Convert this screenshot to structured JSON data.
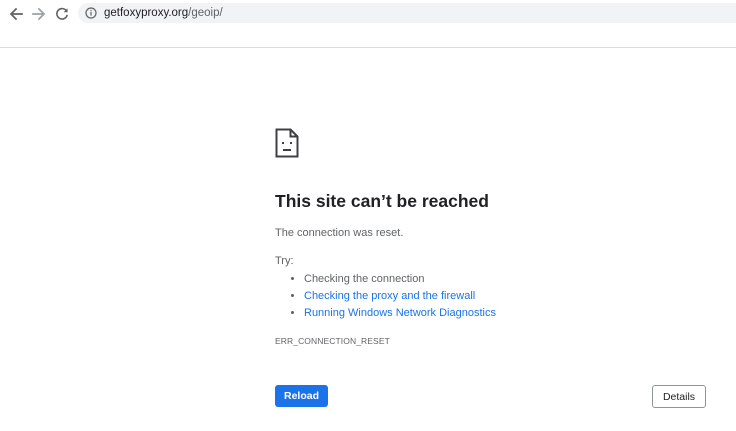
{
  "browser": {
    "url_host": "getfoxyproxy.org",
    "url_path": "/geoip/",
    "icons": {
      "back": "back-arrow-icon",
      "forward": "forward-arrow-icon",
      "reload": "reload-icon",
      "site_info": "info-icon"
    }
  },
  "error_page": {
    "icon": "sad-document-icon",
    "heading": "This site can’t be reached",
    "subtext": "The connection was reset.",
    "try_label": "Try:",
    "suggestions": [
      {
        "label": "Checking the connection",
        "link": false
      },
      {
        "label": "Checking the proxy and the firewall",
        "link": true
      },
      {
        "label": "Running Windows Network Diagnostics",
        "link": true
      }
    ],
    "error_code": "ERR_CONNECTION_RESET",
    "reload_label": "Reload",
    "details_label": "Details"
  },
  "colors": {
    "accent": "#1a73e8",
    "text_primary": "#202124",
    "text_secondary": "#5f6368",
    "omnibox_bg": "#f1f3f4"
  }
}
